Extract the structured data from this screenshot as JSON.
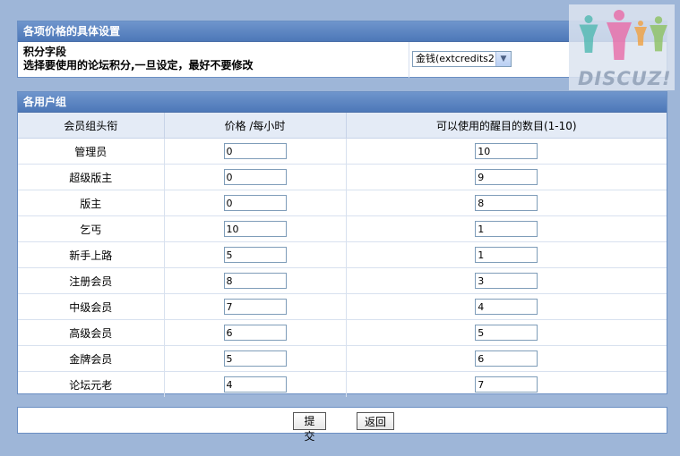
{
  "settings": {
    "title": "各项价格的具体设置",
    "label_line1": "积分字段",
    "label_line2": "选择要使用的论坛积分,一旦设定，最好不要修改",
    "selected_credit": "金钱(extcredits2)"
  },
  "groups": {
    "title": "各用户组",
    "headers": [
      "会员组头衔",
      "价格 /每小时",
      "可以使用的醒目的数目(1-10)"
    ],
    "rows": [
      {
        "name": "管理员",
        "price": "0",
        "count": "10"
      },
      {
        "name": "超级版主",
        "price": "0",
        "count": "9"
      },
      {
        "name": "版主",
        "price": "0",
        "count": "8"
      },
      {
        "name": "乞丐",
        "price": "10",
        "count": "1"
      },
      {
        "name": "新手上路",
        "price": "5",
        "count": "1"
      },
      {
        "name": "注册会员",
        "price": "8",
        "count": "3"
      },
      {
        "name": "中级会员",
        "price": "7",
        "count": "4"
      },
      {
        "name": "高级会员",
        "price": "6",
        "count": "5"
      },
      {
        "name": "金牌会员",
        "price": "5",
        "count": "6"
      },
      {
        "name": "论坛元老",
        "price": "4",
        "count": "7"
      }
    ]
  },
  "actions": {
    "submit_label": "提 交",
    "back_label": "返回"
  },
  "logo": {
    "text": "DISCUZ!",
    "colors": {
      "teal": "#4fb8b0",
      "pink": "#e86aa6",
      "purple": "#9a6fc0",
      "orange": "#f0a040",
      "green": "#8cc060"
    }
  }
}
